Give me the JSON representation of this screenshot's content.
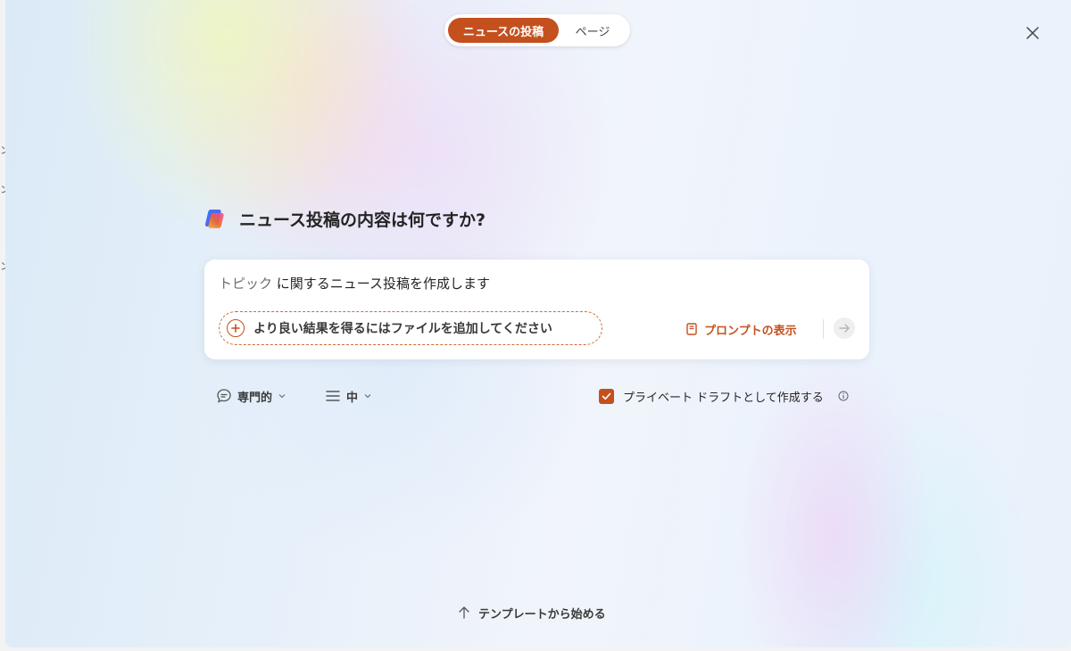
{
  "tabs": [
    {
      "label": "ニュースの投稿",
      "active": true
    },
    {
      "label": "ページ",
      "active": false
    }
  ],
  "heading": "ニュース投稿の内容は何ですか?",
  "prompt": {
    "token": "トピック",
    "text": " に関するニュース投稿を作成します"
  },
  "attach_label": "より良い結果を得るにはファイルを追加してください",
  "show_prompts_label": "プロンプトの表示",
  "options": {
    "tone_label": "専門的",
    "length_label": "中",
    "private_draft_label": "プライベート ドラフトとして作成する",
    "private_draft_checked": true
  },
  "template_label": "テンプレートから始める",
  "colors": {
    "accent": "#c4501e",
    "text": "#242424"
  },
  "icons": [
    "copilot-icon",
    "close-icon",
    "plus-circle-icon",
    "prompt-book-icon",
    "send-arrow-icon",
    "chat-bubble-icon",
    "lines-icon",
    "chevron-down-icon",
    "checkmark-icon",
    "info-icon",
    "arrow-up-icon"
  ]
}
